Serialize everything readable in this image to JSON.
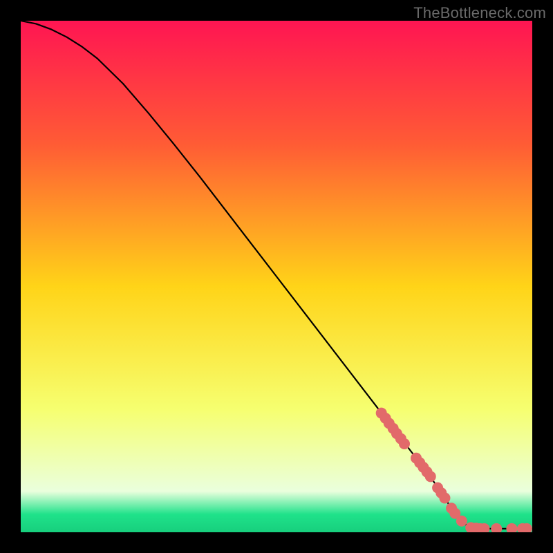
{
  "watermark": "TheBottleneck.com",
  "colors": {
    "background": "#000000",
    "curve": "#000000",
    "marker_fill": "#e26a6a",
    "marker_stroke": "#c85a5a",
    "grad_top": "#ff1552",
    "grad_upper": "#ff5b35",
    "grad_mid": "#ffd418",
    "grad_lower": "#f6ff70",
    "grad_pale": "#eaffdd",
    "grad_green": "#1fe28a",
    "grad_green2": "#17cf7d"
  },
  "chart_data": {
    "type": "line",
    "title": "",
    "xlabel": "",
    "ylabel": "",
    "xlim": [
      0,
      100
    ],
    "ylim": [
      0,
      100
    ],
    "curve": [
      {
        "x": 0,
        "y": 100.0
      },
      {
        "x": 3,
        "y": 99.4
      },
      {
        "x": 6,
        "y": 98.3
      },
      {
        "x": 9,
        "y": 96.8
      },
      {
        "x": 12,
        "y": 94.9
      },
      {
        "x": 15,
        "y": 92.6
      },
      {
        "x": 20,
        "y": 87.7
      },
      {
        "x": 25,
        "y": 81.9
      },
      {
        "x": 30,
        "y": 75.8
      },
      {
        "x": 35,
        "y": 69.5
      },
      {
        "x": 40,
        "y": 63.0
      },
      {
        "x": 45,
        "y": 56.5
      },
      {
        "x": 50,
        "y": 50.0
      },
      {
        "x": 55,
        "y": 43.5
      },
      {
        "x": 60,
        "y": 37.0
      },
      {
        "x": 65,
        "y": 30.5
      },
      {
        "x": 70,
        "y": 24.0
      },
      {
        "x": 75,
        "y": 17.5
      },
      {
        "x": 80,
        "y": 11.0
      },
      {
        "x": 83,
        "y": 6.5
      },
      {
        "x": 85,
        "y": 3.5
      },
      {
        "x": 86,
        "y": 2.3
      },
      {
        "x": 87,
        "y": 1.5
      },
      {
        "x": 88,
        "y": 1.0
      },
      {
        "x": 89,
        "y": 0.8
      },
      {
        "x": 90,
        "y": 0.7
      },
      {
        "x": 92,
        "y": 0.7
      },
      {
        "x": 95,
        "y": 0.7
      },
      {
        "x": 98,
        "y": 0.7
      },
      {
        "x": 100,
        "y": 0.7
      }
    ],
    "markers": [
      {
        "x": 70.5,
        "y": 23.3
      },
      {
        "x": 71.3,
        "y": 22.3
      },
      {
        "x": 72.0,
        "y": 21.3
      },
      {
        "x": 72.8,
        "y": 20.3
      },
      {
        "x": 73.5,
        "y": 19.3
      },
      {
        "x": 74.3,
        "y": 18.3
      },
      {
        "x": 75.0,
        "y": 17.3
      },
      {
        "x": 77.3,
        "y": 14.5
      },
      {
        "x": 78.0,
        "y": 13.6
      },
      {
        "x": 78.7,
        "y": 12.7
      },
      {
        "x": 79.4,
        "y": 11.8
      },
      {
        "x": 80.1,
        "y": 10.9
      },
      {
        "x": 81.5,
        "y": 8.7
      },
      {
        "x": 82.2,
        "y": 7.7
      },
      {
        "x": 82.9,
        "y": 6.7
      },
      {
        "x": 84.2,
        "y": 4.7
      },
      {
        "x": 84.9,
        "y": 3.7
      },
      {
        "x": 86.2,
        "y": 2.2
      },
      {
        "x": 88.0,
        "y": 0.9
      },
      {
        "x": 89.0,
        "y": 0.8
      },
      {
        "x": 89.8,
        "y": 0.7
      },
      {
        "x": 90.6,
        "y": 0.7
      },
      {
        "x": 93.0,
        "y": 0.7
      },
      {
        "x": 96.0,
        "y": 0.7
      },
      {
        "x": 98.1,
        "y": 0.7
      },
      {
        "x": 98.9,
        "y": 0.7
      }
    ]
  }
}
